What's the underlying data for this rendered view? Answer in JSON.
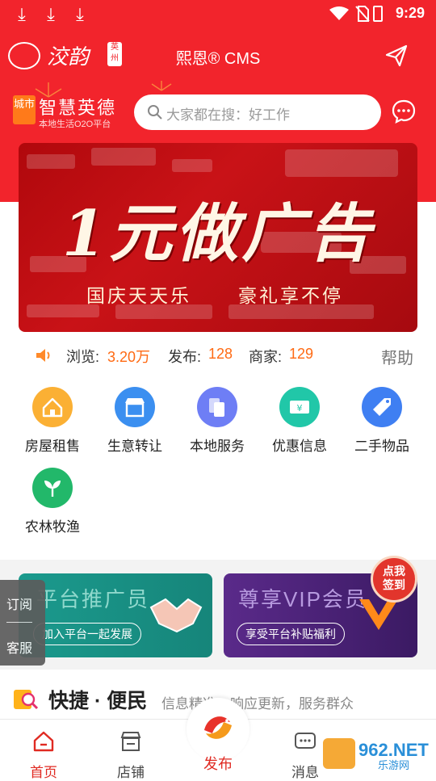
{
  "status_bar": {
    "time": "9:29"
  },
  "header": {
    "logo_text": "洨韵",
    "logo_stamp": "英州",
    "title": "熙恩® CMS"
  },
  "city": {
    "badge": "城市",
    "name": "智慧英德",
    "subtitle": "本地生活O2O平台"
  },
  "search": {
    "placeholder": "大家都在搜：好工作"
  },
  "banner": {
    "title": "1元做广告",
    "left_text": "国庆天天乐",
    "right_text": "豪礼享不停"
  },
  "stats": {
    "views_label": "浏览:",
    "views_value": "3.20万",
    "posts_label": "发布:",
    "posts_value": "128",
    "merchants_label": "商家:",
    "merchants_value": "129",
    "help_label": "帮助"
  },
  "categories": [
    {
      "label": "房屋租售",
      "icon": "house-icon",
      "color": "#fbb034"
    },
    {
      "label": "生意转让",
      "icon": "store-icon",
      "color": "#3b8ff0"
    },
    {
      "label": "本地服务",
      "icon": "copy-icon",
      "color": "#6e7ef5"
    },
    {
      "label": "优惠信息",
      "icon": "coupon-icon",
      "color": "#21c7a8"
    },
    {
      "label": "二手物品",
      "icon": "tag-icon",
      "color": "#3f7ff2"
    },
    {
      "label": "农林牧渔",
      "icon": "sprout-icon",
      "color": "#22b86a"
    }
  ],
  "promos": {
    "promoter_title": "平台推广员",
    "promoter_button": "加入平台一起发展",
    "vip_title": "尊享VIP会员",
    "vip_button": "享受平台补贴福利"
  },
  "side_tab": {
    "subscribe": "订阅",
    "service": "客服"
  },
  "checkin": {
    "line1": "点我",
    "line2": "签到"
  },
  "quick": {
    "title": "快捷 · 便民",
    "subtitle": "信息精准，响应更新，服务群众"
  },
  "tabbar": {
    "home": "首页",
    "shop": "店铺",
    "publish": "发布",
    "message": "消息"
  },
  "watermark": {
    "brand": "962.NET",
    "sub": "乐游网"
  },
  "colors": {
    "brand_red": "#f2242c",
    "accent_orange": "#ff6a13"
  }
}
